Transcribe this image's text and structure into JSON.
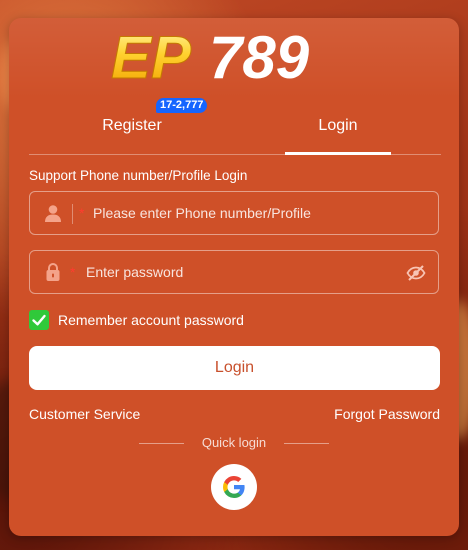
{
  "brand": {
    "logo_text": "EP789"
  },
  "tabs": [
    {
      "label": "Register",
      "badge": "17-2,777",
      "active": false
    },
    {
      "label": "Login",
      "active": true
    }
  ],
  "form": {
    "support_text": "Support Phone number/Profile Login",
    "phone_placeholder": "Please enter Phone number/Profile",
    "password_placeholder": "Enter password",
    "required_mark": "*",
    "remember_label": "Remember account password",
    "remember_checked": true,
    "login_button": "Login"
  },
  "links": {
    "customer_service": "Customer Service",
    "forgot_password": "Forgot Password"
  },
  "quick_login": {
    "label": "Quick login",
    "providers": [
      "google-icon"
    ]
  },
  "colors": {
    "card_bg": "#cf5028",
    "badge_bg": "#1565ff",
    "checkbox_green": "#30c93a",
    "required_red": "#ff3b2f"
  }
}
